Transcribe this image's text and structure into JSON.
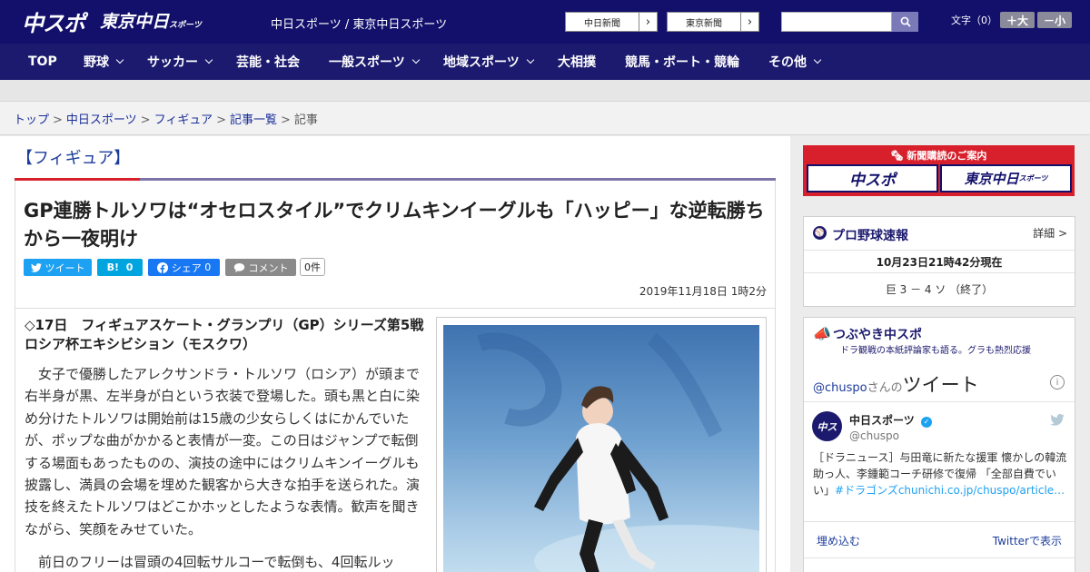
{
  "header": {
    "logo_main": "中スポ",
    "logo_tokyo": "東京中日",
    "logo_tokyo_sub": "スポーツ",
    "site_names": "中日スポーツ / 東京中日スポーツ",
    "ext_links": [
      "中日新聞",
      "東京新聞"
    ],
    "font_size_label": "文字（0）",
    "font_bigger": "＋大",
    "font_smaller": "－小"
  },
  "nav": {
    "items": [
      {
        "label": "TOP"
      },
      {
        "label": "野球"
      },
      {
        "label": "サッカー"
      },
      {
        "label": "芸能・社会"
      },
      {
        "label": "一般スポーツ"
      },
      {
        "label": "地域スポーツ"
      },
      {
        "label": "大相撲"
      },
      {
        "label": "競馬・ボート・競輪"
      },
      {
        "label": "その他"
      }
    ]
  },
  "breadcrumb": {
    "links": [
      "トップ",
      "中日スポーツ",
      "フィギュア",
      "記事一覧"
    ],
    "current": "記事",
    "separator": ">"
  },
  "article": {
    "category": "【フィギュア】",
    "headline": "GP連勝トルソワは“オセロスタイル”でクリムキンイーグルも「ハッピー」な逆転勝ちから一夜明け",
    "share": {
      "tweet": "ツイート",
      "hatena": "B!",
      "hatena_count": "0",
      "facebook": "シェア",
      "facebook_count": "0",
      "comment": "コメント",
      "comment_count": "0件"
    },
    "date": "2019年11月18日 1時2分",
    "subhead": "◇17日　フィギュアスケート・グランプリ（GP）シリーズ第5戦ロシア杯エキシビション（モスクワ）",
    "paragraphs": [
      "女子で優勝したアレクサンドラ・トルソワ（ロシア）が頭まで右半身が黒、左半身が白という衣装で登場した。頭も黒と白に染め分けたトルソワは開始前は15歳の少女らしくはにかんでいたが、ポップな曲がかかると表情が一変。この日はジャンプで転倒する場面もあったものの、演技の途中にはクリムキンイーグルも披露し、満員の会場を埋めた観客から大きな拍手を送られた。演技を終えたトルソワはどこかホッとしたような表情。歓声を聞きながら、笑顔をみせていた。",
      "前日のフリーは冒頭の4回転サルコーで転倒も、4回転ルッ"
    ]
  },
  "sidebar": {
    "promo": {
      "title": "新聞購読のご案内",
      "logo_chuspo": "中スポ",
      "logo_tokyo": "東京中日",
      "logo_tokyo_sub": "スポーツ"
    },
    "baseball": {
      "title": "プロ野球速報",
      "detail": "詳細 >",
      "updated": "10月23日21時42分現在",
      "score": "巨 3 － 4 ソ （終了）"
    },
    "tsubuyaki": {
      "title": "つぶやき中スポ",
      "subtitle": "ドラ観戦の本紙評論家も語る。グラも熱烈応援"
    },
    "twitter": {
      "handle_prefix": "@chuspo",
      "handle_suffix": "さんの",
      "heading": "ツイート",
      "account_name": "中日スポーツ",
      "account_handle": "@chuspo",
      "tweet_text": "［ドラニュース］与田竜に新たな援軍 懐かしの韓流助っ人、李鍾範コーチ研修で復帰 「全部自費でい",
      "tweet_tail": "い」",
      "tweet_link": "#ドラゴンズchunichi.co.jp/chuspo/article…",
      "embed": "埋め込む",
      "view_on_twitter": "Twitterで表示"
    }
  },
  "colors": {
    "header_bg": "#12106b",
    "nav_bg": "#1c1a6e",
    "accent_red": "#d8202c",
    "link_blue": "#1a2f9a",
    "twitter_blue": "#1da1f2",
    "facebook_blue": "#1877f2"
  }
}
